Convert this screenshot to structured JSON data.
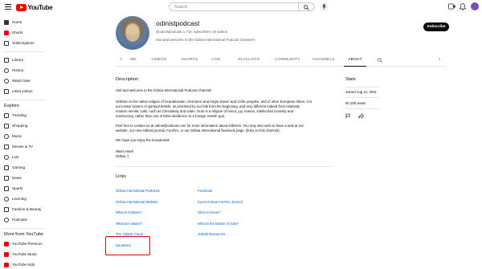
{
  "topbar": {
    "logo_text": "YouTube",
    "search_placeholder": "Search"
  },
  "sidebar": {
    "items": [
      {
        "label": "Home",
        "icon": "home-icon"
      },
      {
        "label": "Shorts",
        "icon": "shorts-icon"
      },
      {
        "label": "Subscriptions",
        "icon": "subscriptions-icon"
      },
      {
        "label": "Library",
        "icon": "library-icon"
      },
      {
        "label": "History",
        "icon": "history-icon"
      },
      {
        "label": "Watch later",
        "icon": "clock-icon"
      },
      {
        "label": "Liked videos",
        "icon": "thumbs-up-icon"
      }
    ],
    "explore_heading": "Explore",
    "explore": [
      {
        "label": "Trending",
        "icon": "flame-icon"
      },
      {
        "label": "Shopping",
        "icon": "bag-icon"
      },
      {
        "label": "Music",
        "icon": "music-icon"
      },
      {
        "label": "Movies & TV",
        "icon": "film-icon"
      },
      {
        "label": "Live",
        "icon": "live-icon"
      },
      {
        "label": "Gaming",
        "icon": "gamepad-icon"
      },
      {
        "label": "News",
        "icon": "news-icon"
      },
      {
        "label": "Sports",
        "icon": "trophy-icon"
      },
      {
        "label": "Learning",
        "icon": "bulb-icon"
      },
      {
        "label": "Fashion & Beauty",
        "icon": "hanger-icon"
      },
      {
        "label": "Podcasts",
        "icon": "podcast-icon"
      }
    ],
    "more_heading": "More from YouTube",
    "more": [
      {
        "label": "YouTube Premium",
        "icon": "youtube-premium-icon"
      },
      {
        "label": "YouTube Music",
        "icon": "youtube-music-icon"
      },
      {
        "label": "YouTube Kids",
        "icon": "youtube-kids-icon"
      }
    ]
  },
  "channel": {
    "name": "odinistpodcast",
    "meta": "@odinistpodcast  1.71K subscribers  19 videos",
    "desc": "Hail and welcome to the Odinia International Podcast Channel!",
    "subscribe_label": "Subscribe"
  },
  "tabs": [
    "ME",
    "VIDEOS",
    "SHORTS",
    "LIVE",
    "PLAYLISTS",
    "COMMUNITY",
    "CHANNELS",
    "ABOUT"
  ],
  "about": {
    "description_title": "Description",
    "para1": "Hail and welcome to the Odinia International Podcast Channel!",
    "para2": [
      "Odinism is the native religion of Scandinavian, Germanic and Anglo-Saxon and Celtic peoples, and of other European tribes. It is",
      "our innate system of spiritual beliefs, as practised by our folk from the beginning, and very different indeed from relatively",
      "modern semitic cults, such as Christianity and Islam.  Ours is a religion of honor, joy, reason, intellectual curiosity and",
      "meritocracy, rather than one of blind obedience to a foreign Jewish god."
    ],
    "para3": [
      "Feel free to contact us at odinia@outlook.com for more information about Odinism. You may also wish to have a look at our",
      "website, our new Odinist journal, FooFire, or our Odinia International facebook page. (links on this channel)."
    ],
    "para4": "We hope you enjoy the  broadcasts!",
    "signoff1": "Waes Hael!",
    "signoff2": "Odinia :)",
    "links_title": "Links",
    "links_left": [
      "Odinia International Podcasts",
      "Odinia International Website",
      "What is Odinism?",
      "What are Values?",
      "The Odinist Creed",
      "Donations"
    ],
    "links_right": [
      "Facebook",
      "Current Issue FooFire Journal",
      "What is Honor?",
      "What is the Nation of Odin?",
      "Odinist Resources..."
    ]
  },
  "stats": {
    "title": "Stats",
    "joined": "Joined Aug 21, 2011",
    "views": "80,150 views"
  },
  "colors": {
    "accent_red": "#ff0000",
    "link_blue": "#065fd4",
    "highlight_box": "#e10000"
  }
}
